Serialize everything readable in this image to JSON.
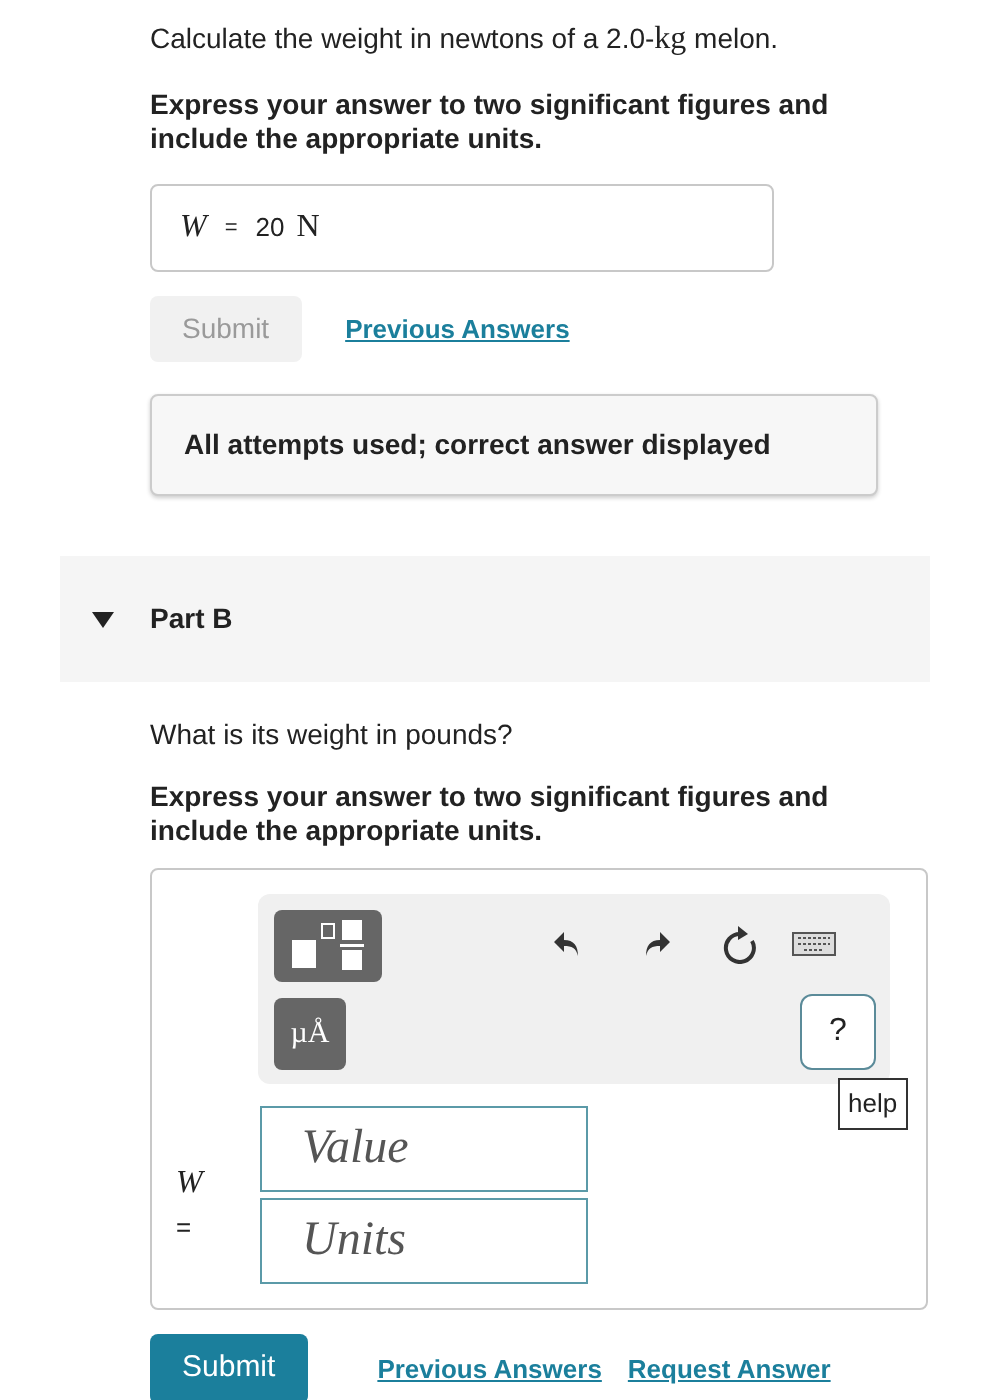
{
  "part_a": {
    "prompt": {
      "before": "Calculate the weight in newtons of a 2.0-",
      "unit": "kg",
      "after": " melon."
    },
    "instructions": "Express your answer to two significant figures and include the appropriate units.",
    "answer": {
      "variable": "W",
      "equals": "=",
      "value": "20",
      "unit": "N"
    },
    "submit": {
      "label": "Submit",
      "disabled": true
    },
    "links": [
      "Previous Answers"
    ],
    "feedback": "All attempts used; correct answer displayed"
  },
  "part_b": {
    "title": "Part B",
    "expanded": true,
    "question": "What is its weight in pounds?",
    "instructions": "Express your answer to two significant figures and include the appropriate units.",
    "toolbar": {
      "units_key": "µÅ",
      "help_key": "?",
      "tooltip": "help"
    },
    "variable": "W",
    "equals": "=",
    "fields": [
      {
        "placeholder": "Value"
      },
      {
        "placeholder": "Units"
      }
    ],
    "submit": {
      "label": "Submit",
      "disabled": false
    },
    "links": [
      "Previous Answers",
      "Request Answer"
    ]
  }
}
